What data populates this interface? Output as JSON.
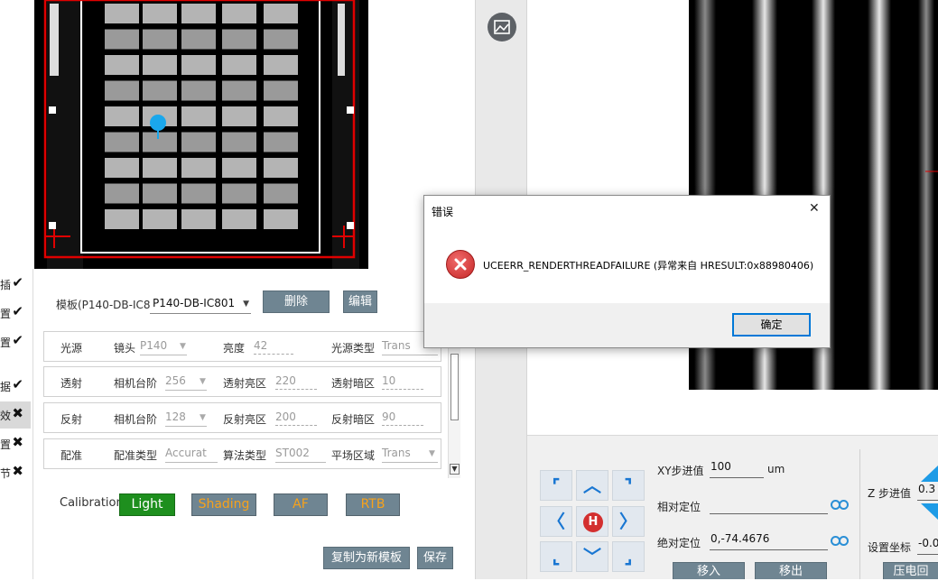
{
  "status_strip": {
    "items": [
      {
        "label": "插",
        "mark": "✔"
      },
      {
        "label": "置",
        "mark": "✔"
      },
      {
        "label": "置",
        "mark": "✔"
      },
      {
        "label": "据",
        "mark": "✔"
      },
      {
        "label": "效",
        "mark": "✖"
      },
      {
        "label": "置",
        "mark": "✖"
      },
      {
        "label": "节",
        "mark": "✖"
      }
    ]
  },
  "template": {
    "label": "模板(P140-DB-IC8",
    "selected": "P140-DB-IC801",
    "delete_label": "删除",
    "edit_label": "编辑"
  },
  "rows": {
    "light_source": {
      "title": "光源",
      "lens_label": "镜头",
      "lens_value": "P140",
      "brightness_label": "亮度",
      "brightness_value": "42",
      "type_label": "光源类型",
      "type_value": "Trans"
    },
    "transmission": {
      "title": "透射",
      "gain_label": "相机台阶",
      "gain_value": "256",
      "bright_label": "透射亮区",
      "bright_value": "220",
      "dark_label": "透射暗区",
      "dark_value": "10"
    },
    "reflection": {
      "title": "反射",
      "gain_label": "相机台阶",
      "gain_value": "128",
      "bright_label": "反射亮区",
      "bright_value": "200",
      "dark_label": "反射暗区",
      "dark_value": "90"
    },
    "alignment": {
      "title": "配准",
      "type_label": "配准类型",
      "type_value": "Accurat",
      "algo_label": "算法类型",
      "algo_value": "ST002",
      "flat_label": "平场区域",
      "flat_value": "Trans"
    }
  },
  "calibration": {
    "label": "Calibration",
    "buttons": [
      {
        "label": "Light",
        "bg": "#1e8f1e",
        "fg": "#ffffff"
      },
      {
        "label": "Shading",
        "bg": "#6f8592",
        "fg": "#f7a21b"
      },
      {
        "label": "AF",
        "bg": "#6f8592",
        "fg": "#f7a21b"
      },
      {
        "label": "RTB",
        "bg": "#6f8592",
        "fg": "#f7a21b"
      }
    ]
  },
  "footer_buttons": {
    "copy_new": "复制为新模板",
    "save": "保存"
  },
  "motion": {
    "xy_step_label": "XY步进值",
    "xy_step_value": "100",
    "xy_unit": "um",
    "relative_label": "相对定位",
    "relative_value": "",
    "absolute_label": "绝对定位",
    "absolute_value": "0,-74.4676",
    "move_in": "移入",
    "move_out": "移出",
    "z_step_label": "Z 步进值",
    "z_step_value": "0.3",
    "set_coord_label": "设置坐标",
    "set_coord_value": "-0.0",
    "power_button": "压电回",
    "home_label": "H"
  },
  "dialog": {
    "title": "错误",
    "message": "UCEERR_RENDERTHREADFAILURE (异常来自 HRESULT:0x88980406)",
    "ok_label": "确定",
    "close_glyph": "✕"
  },
  "colors": {
    "accent": "#6f8592",
    "error_red": "#d32f2f",
    "jog_arrow": "#1976d2",
    "marker": "#1aa7ec"
  }
}
